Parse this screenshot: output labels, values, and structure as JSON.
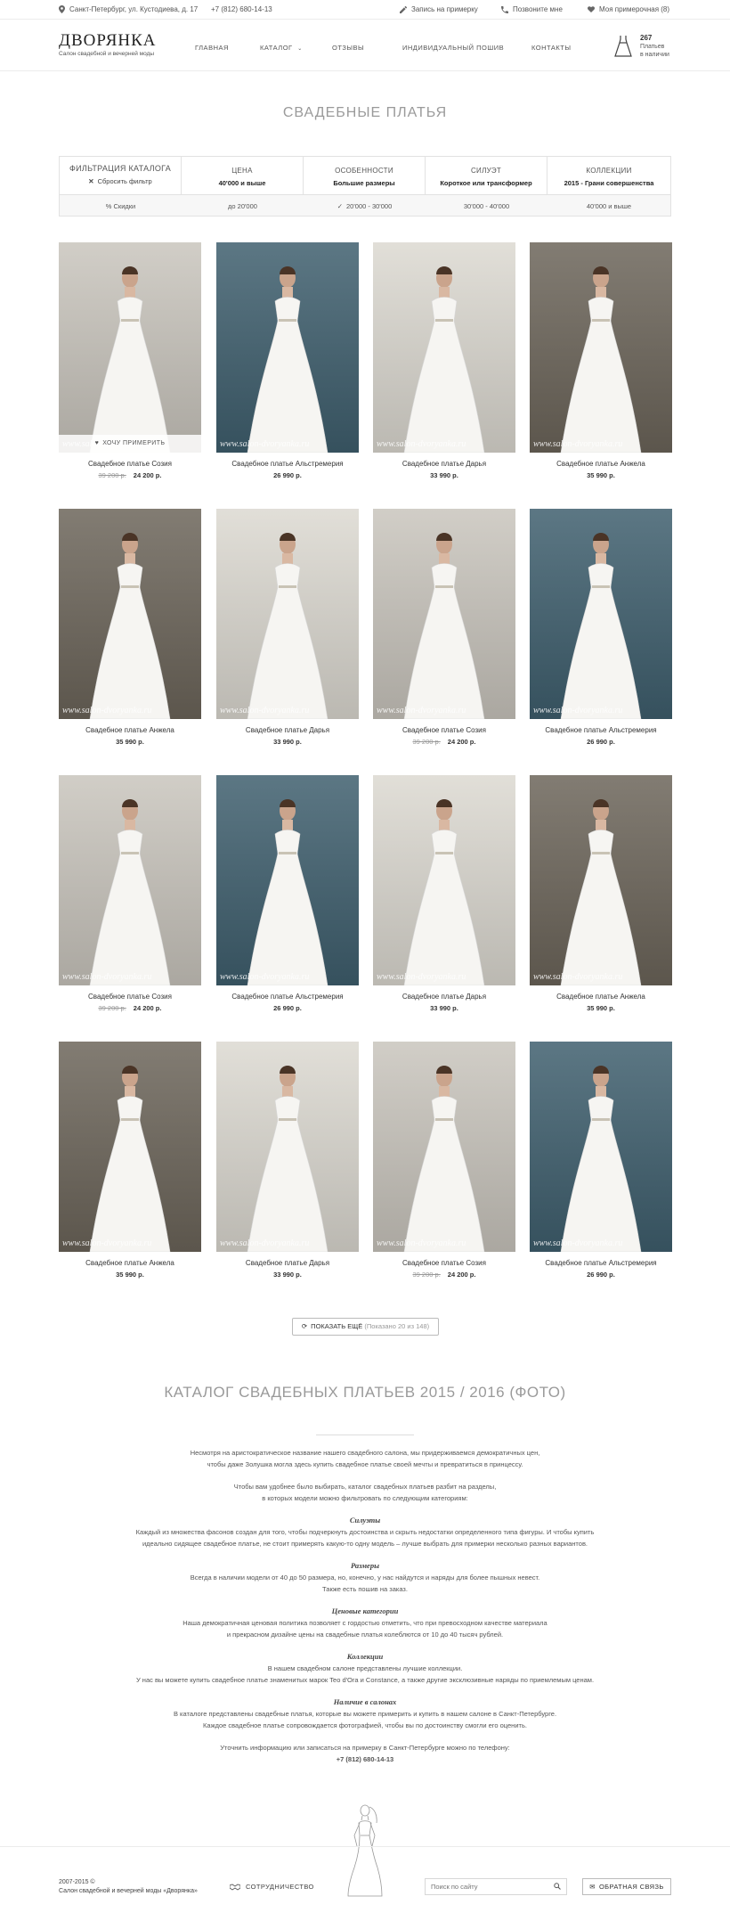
{
  "topbar": {
    "address": "Санкт-Петербург, ул. Кустодиева, д. 17",
    "phone": "+7 (812) 680-14-13",
    "signup": "Запись на примерку",
    "call_me": "Позвоните мне",
    "my_fitting": "Моя примерочная (8)"
  },
  "header": {
    "logo_title": "ДВОРЯНКА",
    "logo_subtitle": "Салон свадебной и вечерней моды",
    "nav": [
      "ГЛАВНАЯ",
      "КАТАЛОГ",
      "ОТЗЫВЫ",
      "ИНДИВИДУАЛЬНЫЙ ПОШИВ",
      "КОНТАКТЫ"
    ],
    "cart_count": "267",
    "cart_line1": "Платьев",
    "cart_line2": "в наличии"
  },
  "page_title": "СВАДЕБНЫЕ ПЛАТЬЯ",
  "filter": {
    "title": "ФИЛЬТРАЦИЯ КАТАЛОГА",
    "reset": "Сбросить фильтр",
    "columns": [
      {
        "label": "ЦЕНА",
        "value": "40'000 и выше"
      },
      {
        "label": "ОСОБЕННОСТИ",
        "value": "Большие размеры"
      },
      {
        "label": "СИЛУЭТ",
        "value": "Короткое или трансформер"
      },
      {
        "label": "КОЛЛЕКЦИИ",
        "value": "2015 - Грани совершенства"
      }
    ],
    "options": [
      "% Скидки",
      "до 20'000",
      "20'000 - 30'000",
      "30'000 - 40'000",
      "40'000 и выше"
    ],
    "selected_option": "20'000 - 30'000"
  },
  "products": [
    {
      "name": "Свадебное платье Созия",
      "old_price": "39 200 р.",
      "price": "24 200 р.",
      "bg": "#c9c5bd",
      "try_on": "ХОЧУ ПРИМЕРИТЬ"
    },
    {
      "name": "Свадебное платье Альстремерия",
      "old_price": "",
      "price": "26 990 р.",
      "bg": "#3f5f6e"
    },
    {
      "name": "Свадебное платье Дарья",
      "old_price": "",
      "price": "33 990 р.",
      "bg": "#dcd9d1"
    },
    {
      "name": "Свадебное платье Анжела",
      "old_price": "",
      "price": "35 990 р.",
      "bg": "#6c655a"
    },
    {
      "name": "Свадебное платье Анжела",
      "old_price": "",
      "price": "35 990 р.",
      "bg": "#6c655a"
    },
    {
      "name": "Свадебное платье Дарья",
      "old_price": "",
      "price": "33 990 р.",
      "bg": "#dcd9d1"
    },
    {
      "name": "Свадебное платье Созия",
      "old_price": "39 200 р.",
      "price": "24 200 р.",
      "bg": "#c9c5bd"
    },
    {
      "name": "Свадебное платье Альстремерия",
      "old_price": "",
      "price": "26 990 р.",
      "bg": "#3f5f6e"
    },
    {
      "name": "Свадебное платье Созия",
      "old_price": "39 200 р.",
      "price": "24 200 р.",
      "bg": "#c9c5bd"
    },
    {
      "name": "Свадебное платье Альстремерия",
      "old_price": "",
      "price": "26 990 р.",
      "bg": "#3f5f6e"
    },
    {
      "name": "Свадебное платье Дарья",
      "old_price": "",
      "price": "33 990 р.",
      "bg": "#dcd9d1"
    },
    {
      "name": "Свадебное платье Анжела",
      "old_price": "",
      "price": "35 990 р.",
      "bg": "#6c655a"
    },
    {
      "name": "Свадебное платье Анжела",
      "old_price": "",
      "price": "35 990 р.",
      "bg": "#6c655a"
    },
    {
      "name": "Свадебное платье Дарья",
      "old_price": "",
      "price": "33 990 р.",
      "bg": "#dcd9d1"
    },
    {
      "name": "Свадебное платье Созия",
      "old_price": "39 200 р.",
      "price": "24 200 р.",
      "bg": "#c9c5bd"
    },
    {
      "name": "Свадебное платье Альстремерия",
      "old_price": "",
      "price": "26 990 р.",
      "bg": "#3f5f6e"
    }
  ],
  "watermark": "www.salon-dvoryanka.ru",
  "show_more": {
    "label": "ПОКАЗАТЬ ЕЩЁ",
    "count": "(Показано 20 из 148)"
  },
  "seo": {
    "title": "КАТАЛОГ СВАДЕБНЫХ ПЛАТЬЕВ 2015 / 2016 (ФОТО)",
    "intro1": "Несмотря на аристократическое название нашего свадебного салона, мы придерживаемся демократичных цен,",
    "intro2": "чтобы даже Золушка могла здесь купить свадебное платье своей мечты и превратиться в принцессу.",
    "intro3": "Чтобы вам удобнее было выбирать, каталог свадебных платьев разбит на разделы,",
    "intro4": "в которых модели можно фильтровать по следующим категориям:",
    "s1_title": "Силуэты",
    "s1_l1": "Каждый из множества фасонов создан для того, чтобы подчеркнуть достоинства и скрыть недостатки определенного типа фигуры. И чтобы купить",
    "s1_l2": "идеально сидящее свадебное платье, не стоит примерять какую-то одну модель – лучше выбрать для примерки несколько разных вариантов.",
    "s2_title": "Размеры",
    "s2_l1": "Всегда в наличии модели от 40 до 50 размера, но, конечно, у нас найдутся и наряды для более пышных невест.",
    "s2_l2": "Также есть пошив на заказ.",
    "s3_title": "Ценовые категории",
    "s3_l1": "Наша демократичная ценовая политика позволяет с гордостью отметить, что при превосходном качестве материала",
    "s3_l2": "и прекрасном дизайне цены на свадебные платья колеблются от 10 до 40 тысяч рублей.",
    "s4_title": "Коллекции",
    "s4_l1": "В нашем свадебном салоне представлены лучшие коллекции.",
    "s4_l2": "У нас вы можете купить свадебное платье знаменитых марок Teo d'Ora и Constance, а также другие эксклюзивные наряды по приемлемым ценам.",
    "s5_title": "Наличие в салонах",
    "s5_l1": "В каталоге представлены свадебные платья, которые вы можете примерить и купить в нашем салоне в Санкт-Петербурге.",
    "s5_l2": "Каждое свадебное платье сопровождается фотографией, чтобы вы по достоинству смогли его оценить.",
    "outro1": "Уточнить информацию или записаться на примерку в Санкт-Петербурге можно по телефону:",
    "outro2": "+7 (812) 680-14-13"
  },
  "footer": {
    "copyright": "2007-2015 ©",
    "salon": "Салон свадебной и вечерней моды «Дворянка»",
    "cooperation": "СОТРУДНИЧЕСТВО",
    "search_placeholder": "Поиск по сайту",
    "feedback": "ОБРАТНАЯ СВЯЗЬ"
  }
}
